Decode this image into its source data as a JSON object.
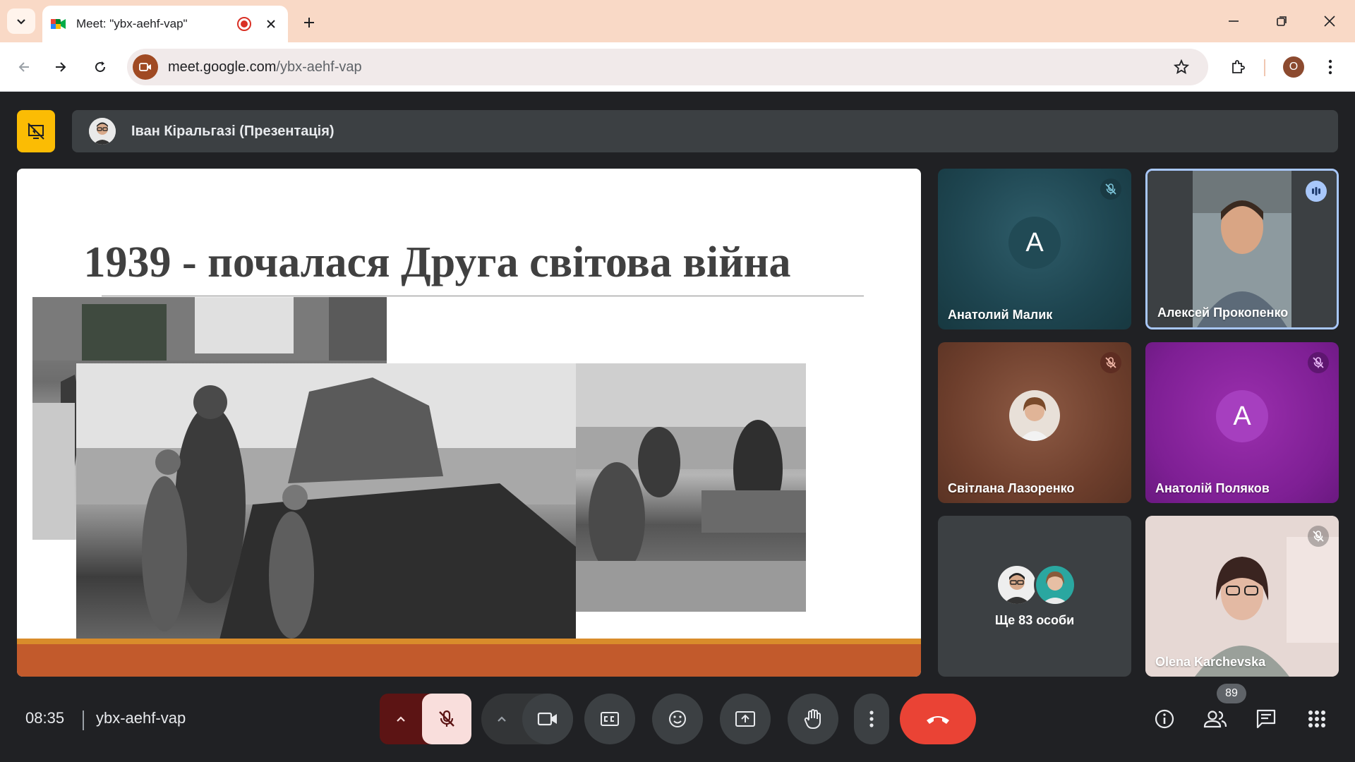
{
  "browser": {
    "tab_title": "Meet: \"ybx-aehf-vap\"",
    "url_host": "meet.google.com",
    "url_path": "/ybx-aehf-vap",
    "profile_initial": "O"
  },
  "meeting": {
    "presenter_label": "Іван Кіральгазі (Презентація)",
    "time": "08:35",
    "code": "ybx-aehf-vap",
    "people_count": "89"
  },
  "slide": {
    "title": "1939 - почалася Друга світова війна"
  },
  "participants": [
    {
      "name": "Анатолий Малик",
      "initial": "A",
      "muted": true
    },
    {
      "name": "Алексей Прокопенко",
      "speaking": true
    },
    {
      "name": "Світлана Лазоренко",
      "muted": true
    },
    {
      "name": "Анатолій Поляков",
      "initial": "A",
      "muted": true
    },
    {
      "name": "Olena Karchevska",
      "muted": true
    }
  ],
  "more_people": "Ще 83 особи",
  "colors": {
    "leave": "#ea4335",
    "present_indicator": "#fbbc04",
    "slide_footer": "#c25a2c"
  }
}
